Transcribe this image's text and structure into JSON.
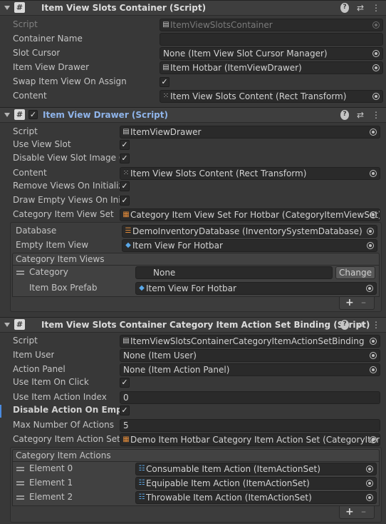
{
  "component1": {
    "title": "Item View Slots Container (Script)",
    "rows": [
      {
        "label": "Script",
        "value": "ItemViewSlotsContainer",
        "icon": "script-file-icon"
      },
      {
        "label": "Container Name",
        "value": ""
      },
      {
        "label": "Slot Cursor",
        "value": "None (Item View Slot Cursor Manager)"
      },
      {
        "label": "Item View Drawer",
        "value": "Item Hotbar (ItemViewDrawer)",
        "icon": "script-file-icon"
      },
      {
        "label": "Swap Item View On Assign",
        "checked": true
      },
      {
        "label": "Content",
        "value": "Item View Slots Content (Rect Transform)",
        "icon": "rect-transform-icon"
      }
    ]
  },
  "component2": {
    "title": "Item View Drawer (Script)",
    "rows": [
      {
        "label": "Script",
        "value": "ItemViewDrawer"
      },
      {
        "label": "Use View Slot",
        "checked": true
      },
      {
        "label": "Disable View Slot Image Co",
        "checked": true
      },
      {
        "label": "Content",
        "value": "Item View Slots Content (Rect Transform)"
      },
      {
        "label": "Remove Views On Initialize",
        "checked": true
      },
      {
        "label": "Draw Empty Views On Initia",
        "checked": true
      },
      {
        "label": "Category Item View Set",
        "value": "Category Item View Set For Hotbar (CategoryItemViewSet)"
      }
    ],
    "sub": {
      "database_label": "Database",
      "database_value": "DemoInventoryDatabase (InventorySystemDatabase)",
      "empty_label": "Empty Item View",
      "empty_value": "Item View For Hotbar",
      "list_title": "Category Item Views",
      "category_label": "Category",
      "category_value": "None",
      "change_label": "Change",
      "prefab_label": "Item Box Prefab",
      "prefab_value": "Item View For Hotbar"
    }
  },
  "component3": {
    "title": "Item View Slots Container Category Item Action Set Binding (Script)",
    "rows": [
      {
        "label": "Script",
        "value": "ItemViewSlotsContainerCategoryItemActionSetBinding"
      },
      {
        "label": "Item User",
        "value": "None (Item User)"
      },
      {
        "label": "Action Panel",
        "value": "None (Item Action Panel)"
      },
      {
        "label": "Use Item On Click",
        "checked": true
      },
      {
        "label": "Use Item Action Index",
        "value": "0"
      },
      {
        "label": "Disable Action On Empty S",
        "checked": true
      },
      {
        "label": "Max Number Of Actions",
        "value": "5"
      },
      {
        "label": "Category Item Action Set",
        "value": "Demo Item Hotbar Category Item Action Set (CategoryItem/"
      }
    ],
    "list_title": "Category Item Actions",
    "elements": [
      {
        "label": "Element 0",
        "value": "Consumable Item Action (ItemActionSet)"
      },
      {
        "label": "Element 1",
        "value": "Equipable Item Action (ItemActionSet)"
      },
      {
        "label": "Element 2",
        "value": "Throwable Item Action (ItemActionSet)"
      }
    ]
  },
  "plus": "+",
  "minus": "–",
  "accent": "#8fb4ea",
  "check": "✓"
}
